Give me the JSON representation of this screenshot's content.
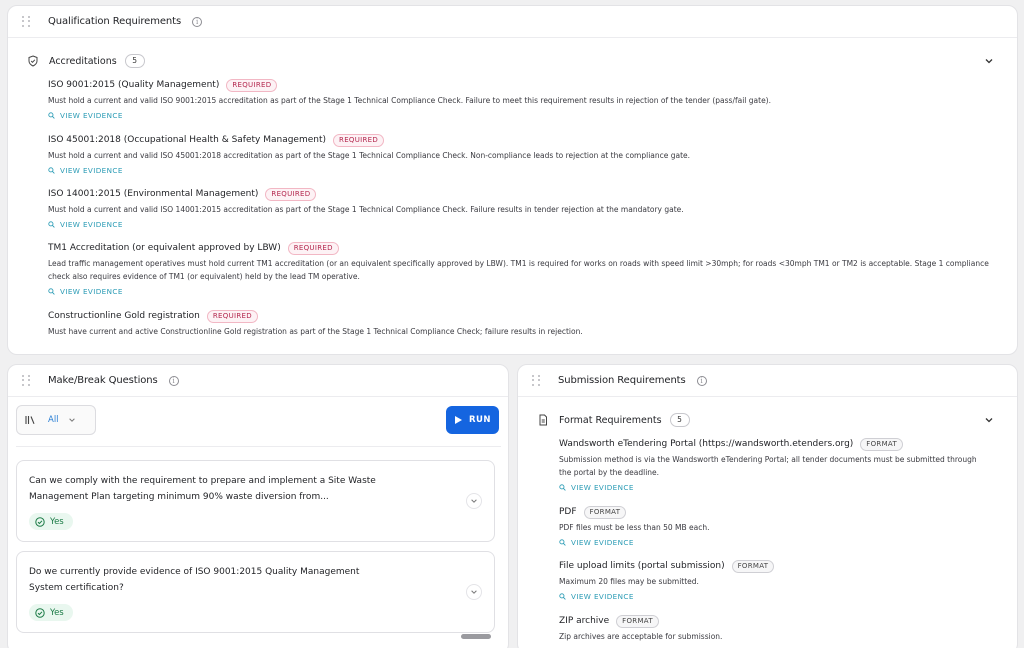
{
  "qualification": {
    "title": "Qualification Requirements",
    "info_icon": "info-icon",
    "section_title": "Accreditations",
    "count": "5",
    "items": [
      {
        "title": "ISO 9001:2015 (Quality Management)",
        "badge": "REQUIRED",
        "desc": "Must hold a current and valid ISO 9001:2015 accreditation as part of the Stage 1 Technical Compliance Check. Failure to meet this requirement results in rejection of the tender (pass/fail gate).",
        "evidence": "VIEW EVIDENCE"
      },
      {
        "title": "ISO 45001:2018 (Occupational Health & Safety Management)",
        "badge": "REQUIRED",
        "desc": "Must hold a current and valid ISO 45001:2018 accreditation as part of the Stage 1 Technical Compliance Check. Non-compliance leads to rejection at the compliance gate.",
        "evidence": "VIEW EVIDENCE"
      },
      {
        "title": "ISO 14001:2015 (Environmental Management)",
        "badge": "REQUIRED",
        "desc": "Must hold a current and valid ISO 14001:2015 accreditation as part of the Stage 1 Technical Compliance Check. Failure results in tender rejection at the mandatory gate.",
        "evidence": "VIEW EVIDENCE"
      },
      {
        "title": "TM1 Accreditation (or equivalent approved by LBW)",
        "badge": "REQUIRED",
        "desc": "Lead traffic management operatives must hold current TM1 accreditation (or an equivalent specifically approved by LBW). TM1 is required for works on roads with speed limit >30mph; for roads <30mph TM1 or TM2 is acceptable. Stage 1 compliance check also requires evidence of TM1 (or equivalent) held by the lead TM operative.",
        "evidence": "VIEW EVIDENCE"
      },
      {
        "title": "Constructionline Gold registration",
        "badge": "REQUIRED",
        "desc": "Must have current and active Constructionline Gold registration as part of the Stage 1 Technical Compliance Check; failure results in rejection."
      }
    ]
  },
  "makebreak": {
    "title": "Make/Break Questions",
    "filter_label": "All",
    "run_label": "RUN",
    "questions": [
      {
        "text": "Can we comply with the requirement to prepare and implement a Site Waste Management Plan targeting minimum 90% waste diversion from...",
        "answer": "Yes"
      },
      {
        "text": "Do we currently provide evidence of ISO 9001:2015 Quality Management System certification?",
        "answer": "Yes"
      }
    ]
  },
  "submission": {
    "title": "Submission Requirements",
    "section_title": "Format Requirements",
    "count": "5",
    "items": [
      {
        "title": "Wandsworth eTendering Portal (https://wandsworth.etenders.org)",
        "badge": "FORMAT",
        "desc": "Submission method is via the Wandsworth eTendering Portal; all tender documents must be submitted through the portal by the deadline.",
        "evidence": "VIEW EVIDENCE"
      },
      {
        "title": "PDF",
        "badge": "FORMAT",
        "desc": "PDF files must be less than 50 MB each.",
        "evidence": "VIEW EVIDENCE"
      },
      {
        "title": "File upload limits (portal submission)",
        "badge": "FORMAT",
        "desc": "Maximum 20 files may be submitted.",
        "evidence": "VIEW EVIDENCE"
      },
      {
        "title": "ZIP archive",
        "badge": "FORMAT",
        "desc": "Zip archives are acceptable for submission."
      }
    ]
  }
}
